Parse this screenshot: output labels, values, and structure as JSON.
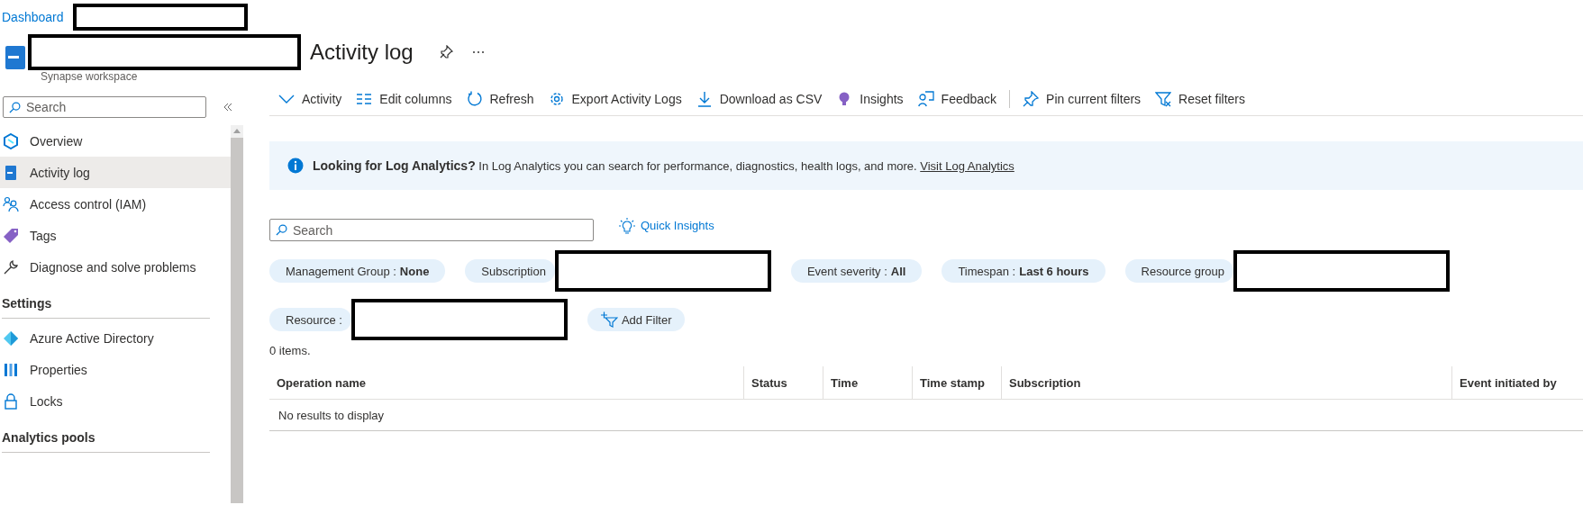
{
  "breadcrumb": {
    "link": "Dashboard"
  },
  "header": {
    "title": "Activity log",
    "subtitle": "Synapse workspace"
  },
  "sidebar": {
    "search": {
      "placeholder": "Search"
    },
    "sections": [
      {
        "items": [
          {
            "label": "Overview",
            "selected": false
          },
          {
            "label": "Activity log",
            "selected": true
          },
          {
            "label": "Access control (IAM)",
            "selected": false
          },
          {
            "label": "Tags",
            "selected": false
          },
          {
            "label": "Diagnose and solve problems",
            "selected": false
          }
        ]
      },
      {
        "title": "Settings",
        "items": [
          {
            "label": "Azure Active Directory",
            "selected": false
          },
          {
            "label": "Properties",
            "selected": false
          },
          {
            "label": "Locks",
            "selected": false
          }
        ]
      },
      {
        "title": "Analytics pools"
      }
    ]
  },
  "toolbar": [
    {
      "label": "Activity"
    },
    {
      "label": "Edit columns"
    },
    {
      "label": "Refresh"
    },
    {
      "label": "Export Activity Logs"
    },
    {
      "label": "Download as CSV"
    },
    {
      "label": "Insights"
    },
    {
      "label": "Feedback",
      "divider_after": true
    },
    {
      "label": "Pin current filters"
    },
    {
      "label": "Reset filters"
    }
  ],
  "banner": {
    "title": "Looking for Log Analytics?",
    "text": "In Log Analytics you can search for performance, diagnostics, health logs, and more.",
    "link": "Visit Log Analytics"
  },
  "search": {
    "placeholder": "Search"
  },
  "quick_insights": "Quick Insights",
  "filters": [
    {
      "label": "Management Group : ",
      "value": "None",
      "kind": "chip"
    },
    {
      "label": "Subscription",
      "kind": "redacted"
    },
    {
      "label": "Event severity : ",
      "value": "All",
      "kind": "chip"
    },
    {
      "label": "Timespan : ",
      "value": "Last 6 hours",
      "kind": "chip"
    },
    {
      "label": "Resource group",
      "kind": "redacted"
    },
    {
      "label": "Resource : ",
      "kind": "redacted"
    },
    {
      "label": "Add Filter",
      "kind": "add"
    }
  ],
  "count": "0 items.",
  "table": {
    "columns": [
      "Operation name",
      "Status",
      "Time",
      "Time stamp",
      "Subscription",
      "Event initiated by"
    ],
    "empty": "No results to display"
  }
}
